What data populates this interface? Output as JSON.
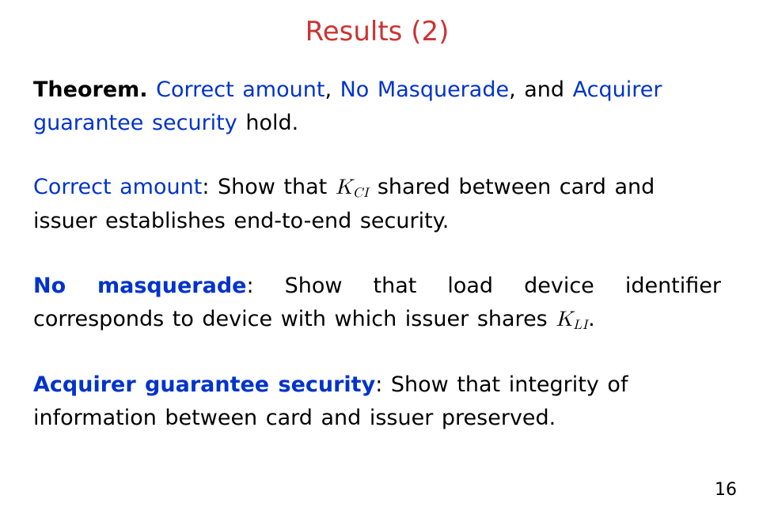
{
  "title": "Results (2)",
  "theorem": {
    "label": "Theorem.",
    "text_a": "Correct amount",
    "text_b": "No Masquerade",
    "text_c": "Acquirer guarantee security"
  },
  "correct_amount": {
    "label": "Correct amount",
    "before_k": ": Show that ",
    "k": "K",
    "ksub": "CI",
    "after_k": " shared between card and issuer establishes end-to-end security."
  },
  "no_masquerade": {
    "label": "No masquerade",
    "before_k": ": Show that load device identifier corresponds to device with which issuer shares ",
    "k": "K",
    "ksub": "LI",
    "after_k": "."
  },
  "acquirer": {
    "label": "Acquirer guarantee security",
    "text": ": Show that integrity of information between card and issuer preserved."
  },
  "page_number": "16"
}
